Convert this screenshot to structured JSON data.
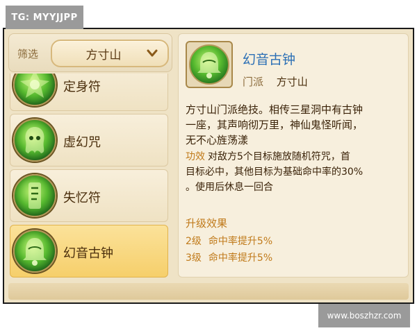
{
  "watermarks": {
    "top_left": "TG: MYYJJPP",
    "bottom_right": "www.boszhzr.com"
  },
  "filter": {
    "label": "筛选",
    "selected": "方寸山",
    "icon": "chevron-down-icon"
  },
  "skills": [
    {
      "name": "定身符",
      "icon": "talisman-skill-icon",
      "selected": false
    },
    {
      "name": "虚幻咒",
      "icon": "phantom-skill-icon",
      "selected": false
    },
    {
      "name": "失忆符",
      "icon": "amnesia-skill-icon",
      "selected": false
    },
    {
      "name": "幻音古钟",
      "icon": "bell-skill-icon",
      "selected": true
    }
  ],
  "detail": {
    "name": "幻音古钟",
    "icon": "bell-skill-icon",
    "school_label": "门派",
    "school_value": "方寸山",
    "description_lines": [
      "方寸山门派绝技。相传三星洞中有古钟",
      "一座，其声响彻万里，神仙鬼怪听闻，",
      "无不心旌荡漾"
    ],
    "effect_label": "功效",
    "effect_lines": [
      "对敌方5个目标施放随机符咒，首",
      "目标必中，其他目标为基础命中率的30%",
      "。使用后休息一回合"
    ],
    "upgrade_title": "升级效果",
    "upgrades": [
      {
        "level": "2级",
        "text": "命中率提升5%"
      },
      {
        "level": "3级",
        "text": "命中率提升5%"
      }
    ]
  },
  "colors": {
    "title_blue": "#2b6fb5",
    "accent_orange": "#c07a1a",
    "selected_gold": "#f6cf6b",
    "panel_bg": "#efe3c6"
  }
}
